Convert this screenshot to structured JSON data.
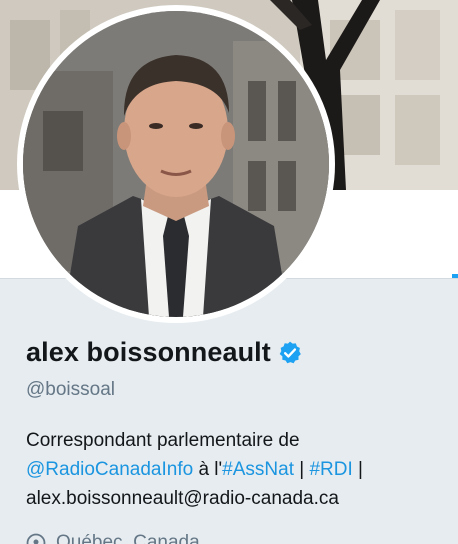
{
  "profile": {
    "display_name": "alex boissonneault",
    "handle": "@boissoal",
    "verified": true,
    "bio": {
      "text_1": "Correspondant parlementaire de",
      "mention": "@RadioCanadaInfo",
      "text_2": " à l'",
      "hashtag_1": "#AssNat",
      "sep_1": " | ",
      "hashtag_2": "#RDI",
      "sep_2": " |",
      "email": "alex.boissonneault@radio-canada.ca"
    },
    "location": "Québec, Canada"
  },
  "colors": {
    "link": "#1b95e0",
    "verified": "#1da1f2",
    "card_bg": "#e6ecf0",
    "secondary_text": "#657786"
  },
  "icons": {
    "verified": "verified-badge-icon",
    "location": "location-pin-icon"
  }
}
